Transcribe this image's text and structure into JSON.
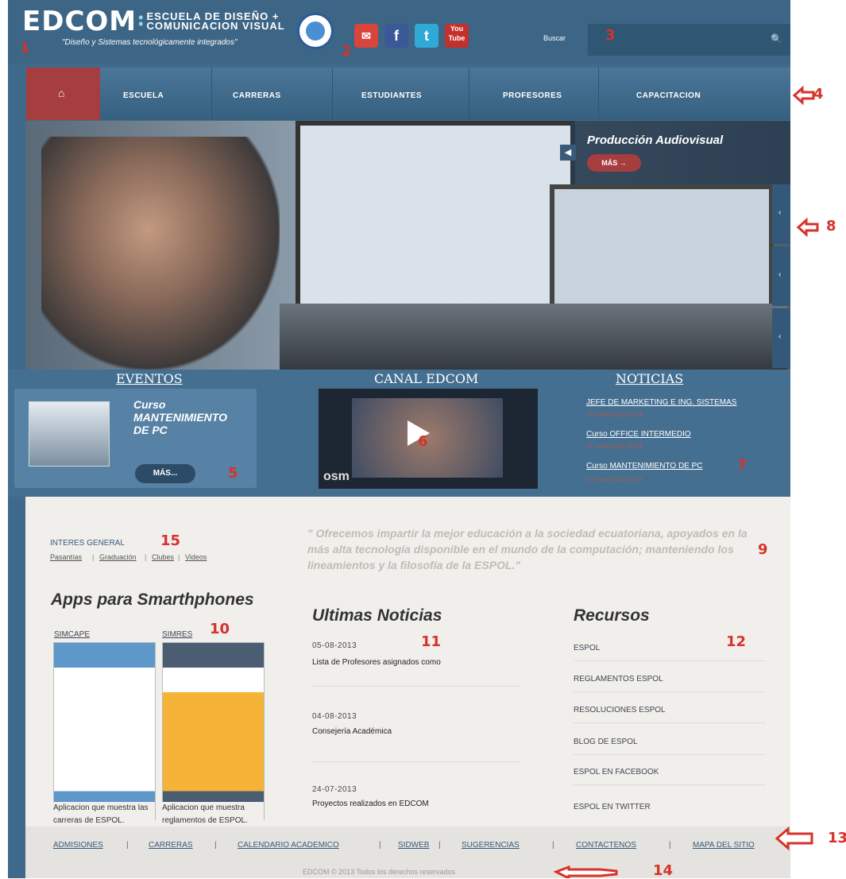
{
  "header": {
    "logo_text": "EDCOM",
    "logo_line1": "ESCUELA DE DISEÑO +",
    "logo_line2": "COMUNICACION VISUAL",
    "tagline": "\"Diseño y Sistemas tecnológicamente integrados\"",
    "social": [
      "mail-icon",
      "facebook-icon",
      "twitter-icon",
      "youtube-icon"
    ],
    "search_label": "Buscar",
    "search_placeholder": ""
  },
  "annotations": [
    "1",
    "2",
    "3",
    "4",
    "5",
    "6",
    "7",
    "8",
    "9",
    "10",
    "11",
    "12",
    "13",
    "14",
    "15"
  ],
  "nav": {
    "items": [
      "ESCUELA",
      "CARRERAS",
      "ESTUDIANTES",
      "PROFESORES",
      "CAPACITACION"
    ]
  },
  "slider": {
    "caption_title": "Producción Audiovisual",
    "caption_button": "MÁS →"
  },
  "band": {
    "eventos_title": "EVENTOS",
    "canal_title": "CANAL EDCOM",
    "noticias_title": "NOTICIAS",
    "event_title_line1": "Curso",
    "event_title_line2": "MANTENIMIENTO",
    "event_title_line3": "DE PC",
    "event_button": "MÁS...",
    "video_watermark": "osm",
    "news": [
      {
        "title": "JEFE DE MARKETING E ING. SISTEMAS",
        "date": "17-Julio-2013 16:19"
      },
      {
        "title": "Curso OFFICE INTERMEDIO",
        "date": "17-Julio-2013 15:55"
      },
      {
        "title": "Curso MANTENIMIENTO DE PC",
        "date": "17-Julio-2013 15:57"
      }
    ]
  },
  "content": {
    "interes_title": "INTERES GENERAL",
    "interes_links": [
      "Pasantías",
      "Graduación",
      "Clubes",
      "Videos"
    ],
    "quote": "\" Ofrecemos impartir la mejor educación a la sociedad ecuatoriana, apoyados en la más alta tecnología disponible en el mundo de la computación; manteniendo los lineamientos y la filosofía de la ESPOL.\"",
    "apps_title": "Apps para Smarthphones",
    "apps": [
      {
        "name": "SIMCAPE",
        "desc": "Aplicacion que muestra las carreras de ESPOL."
      },
      {
        "name": "SIMRES",
        "desc": "Aplicacion que muestra reglamentos de ESPOL."
      }
    ],
    "noticias_title": "Ultimas Noticias",
    "noticias": [
      {
        "date": "05-08-2013",
        "title": "Lista de Profesores asignados como"
      },
      {
        "date": "04-08-2013",
        "title": "Consejería Académica"
      },
      {
        "date": "24-07-2013",
        "title": "Proyectos realizados en EDCOM"
      }
    ],
    "recursos_title": "Recursos",
    "recursos": [
      "ESPOL",
      "REGLAMENTOS ESPOL",
      "RESOLUCIONES ESPOL",
      "BLOG DE ESPOL",
      "ESPOL EN FACEBOOK",
      "ESPOL EN TWITTER"
    ]
  },
  "footer": {
    "links": [
      "ADMISIONES",
      "CARRERAS",
      "CALENDARIO ACADEMICO",
      "SIDWEB",
      "SUGERENCIAS",
      "CONTACTENOS",
      "MAPA DEL SITIO"
    ],
    "separator": "|",
    "copyright": "EDCOM © 2013 Todos los derechos reservados"
  },
  "colors": {
    "header_bg": "#3d6585",
    "nav_home": "#a63d3f",
    "annotation_red": "#d7322b",
    "content_bg": "#f0efeb"
  }
}
